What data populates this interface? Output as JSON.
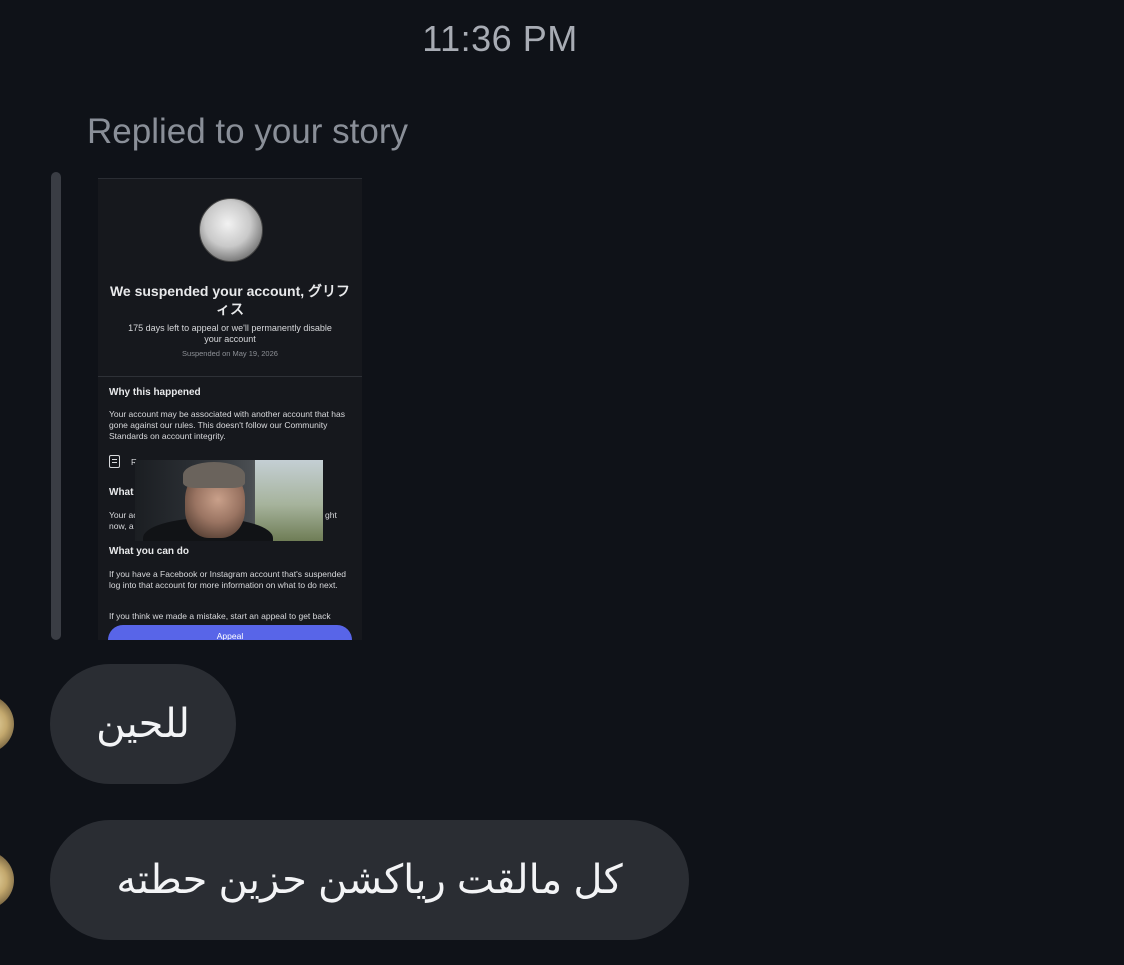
{
  "header": {
    "timestamp": "11:36 PM"
  },
  "story_reply": {
    "label": "Replied to your story",
    "story": {
      "title": "We suspended your account, グリフィス",
      "subtitle": "175 days left to appeal or we'll permanently disable your account",
      "date": "Suspended on May 19, 2026",
      "why_heading": "Why this happened",
      "why_text": "Your account may be associated with another account that has gone against our rules. This doesn't follow our Community Standards on account integrity.",
      "what_heading_partial": "What",
      "what_text_partial_left": "Your ac",
      "what_text_partial_left2": "now, a",
      "what_text_partial_right": "ght",
      "doc_partial": "R",
      "can_do_heading": "What you can do",
      "can_do_text": "If you have a Facebook or Instagram account that's suspended log into that account for more information on what to do next.",
      "can_do_text2": "If you think we made a mistake, start an appeal to get back",
      "appeal_label": "Appeal"
    }
  },
  "messages": [
    {
      "text": "للحين"
    },
    {
      "text": "كل مالقت رياكشن حزين حطته"
    }
  ]
}
